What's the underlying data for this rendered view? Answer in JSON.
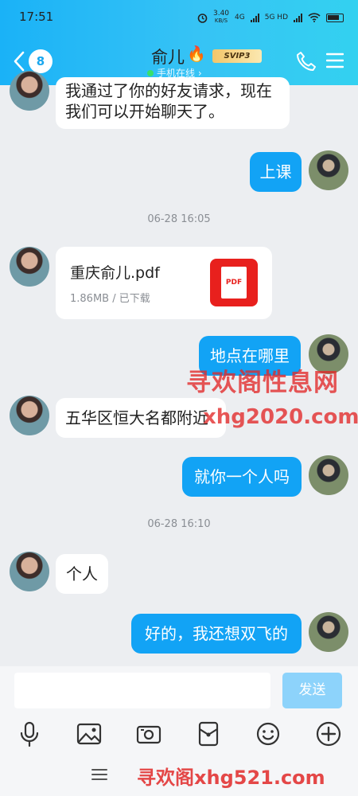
{
  "status_bar": {
    "time": "17:51",
    "speed": "3.40",
    "speed_unit": "KB/S",
    "net1": "4G",
    "net2": "5G HD"
  },
  "header": {
    "unread_count": "8",
    "contact_name": "俞儿",
    "vip_label": "SVIP3",
    "online_status": "手机在线 ›"
  },
  "messages": [
    {
      "side": "left",
      "text": "我通过了你的好友请求，现在我们可以开始聊天了。"
    },
    {
      "side": "right",
      "text": "上课"
    },
    {
      "side": "time",
      "text": "06-28 16:05"
    },
    {
      "side": "left",
      "type": "file",
      "file_name": "重庆俞儿.pdf",
      "file_meta": "1.86MB / 已下载",
      "file_icon_label": "PDF"
    },
    {
      "side": "right",
      "text": "地点在哪里"
    },
    {
      "side": "left",
      "text": "五华区恒大名都附近"
    },
    {
      "side": "right",
      "text": "就你一个人吗"
    },
    {
      "side": "time",
      "text": "06-28 16:10"
    },
    {
      "side": "left",
      "text": "个人"
    },
    {
      "side": "right",
      "text": "好的，我还想双飞的"
    }
  ],
  "watermarks": {
    "line1": "寻欢阁性息网",
    "line2": "xhg2020.com",
    "line3": "寻欢阁xhg521.com"
  },
  "input": {
    "value": "",
    "send_label": "发送"
  },
  "toolbar_icons": [
    "microphone-icon",
    "image-icon",
    "camera-icon",
    "red-packet-icon",
    "emoji-icon",
    "plus-icon"
  ],
  "colors": {
    "header_gradient_start": "#1ab2f7",
    "bubble_right": "#12a3f5",
    "send_disabled": "#8dd3fb"
  }
}
